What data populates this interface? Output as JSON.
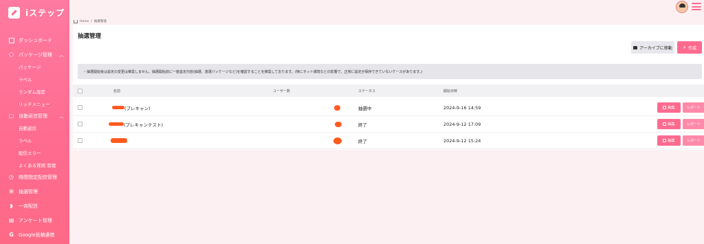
{
  "app": {
    "brand": "iステップ"
  },
  "sidebar": {
    "items": [
      {
        "label": "ダッシュボード",
        "icon": "dashboard-icon"
      },
      {
        "label": "パッケージ管理",
        "icon": "cube-icon",
        "expanded": true,
        "children": [
          "パッケージ",
          "ラベル",
          "ランダム設定",
          "リッチメニュー"
        ]
      },
      {
        "label": "自動返信管理",
        "icon": "chat-icon",
        "expanded": true,
        "children": [
          "自動返信",
          "ラベル",
          "配信エラー",
          "よくある質問 管理"
        ]
      },
      {
        "label": "時間指定配信管理",
        "icon": "clock-icon"
      },
      {
        "label": "抽選管理",
        "icon": "gift-icon"
      },
      {
        "label": "一斉配信",
        "icon": "rss-icon"
      },
      {
        "label": "アンケート管理",
        "icon": "document-icon"
      },
      {
        "label": "Google投稿連携",
        "icon": "google-icon"
      }
    ]
  },
  "breadcrumb": {
    "home": "Home",
    "sep": "/",
    "current": "抽選管理"
  },
  "page": {
    "title": "抽選管理",
    "archive_label": "アーカイブに移動",
    "create_label": "作成",
    "notice": "・抽選開始後は設定の変更は推奨しません。抽選開始前に一度設定内容(抽選、落選パッケージなど)を確認することを推奨しております。(特にネット環境などの影響で、正常に設定が保存できていないケースがあります。)"
  },
  "table": {
    "headers": {
      "name": "名前",
      "user_count": "ユーザー数",
      "status": "ステータス",
      "start": "開始日時"
    },
    "edit_label": "編集",
    "report_label": "レポート",
    "rows": [
      {
        "name": "(プレキャン)",
        "status": "抽選中",
        "start": "2024-9-16 14:59"
      },
      {
        "name": "(プレキャンテスト)",
        "status": "終了",
        "start": "2024-9-12 17:09"
      },
      {
        "name": "",
        "status": "終了",
        "start": "2024-9-12 15:24"
      }
    ]
  },
  "colors": {
    "accent": "#ff6b8f",
    "redaction": "#ff5a1f"
  }
}
